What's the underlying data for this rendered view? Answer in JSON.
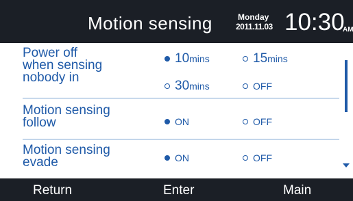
{
  "header": {
    "title": "Motion sensing",
    "day": "Monday",
    "date": "2011.11.03",
    "time": "10:30",
    "ampm": "AM"
  },
  "settings": {
    "power_off": {
      "label_line1": "Power off",
      "label_line2": "when sensing",
      "label_line3": "nobody in",
      "options": [
        {
          "value": "10",
          "unit": "mins",
          "selected": true
        },
        {
          "value": "15",
          "unit": "mins",
          "selected": false
        },
        {
          "value": "30",
          "unit": "mins",
          "selected": false
        },
        {
          "value": "OFF",
          "unit": "",
          "selected": false
        }
      ]
    },
    "follow": {
      "label_line1": "Motion sensing",
      "label_line2": "follow",
      "options": [
        {
          "value": "ON",
          "selected": true
        },
        {
          "value": "OFF",
          "selected": false
        }
      ]
    },
    "evade": {
      "label_line1": "Motion sensing",
      "label_line2": "evade",
      "options": [
        {
          "value": "ON",
          "selected": true
        },
        {
          "value": "OFF",
          "selected": false
        }
      ]
    }
  },
  "footer": {
    "return_label": "Return",
    "enter_label": "Enter",
    "main_label": "Main"
  },
  "colors": {
    "accent": "#1f5aa8",
    "bar": "#1b1f26",
    "separator": "#7aa4d2"
  }
}
